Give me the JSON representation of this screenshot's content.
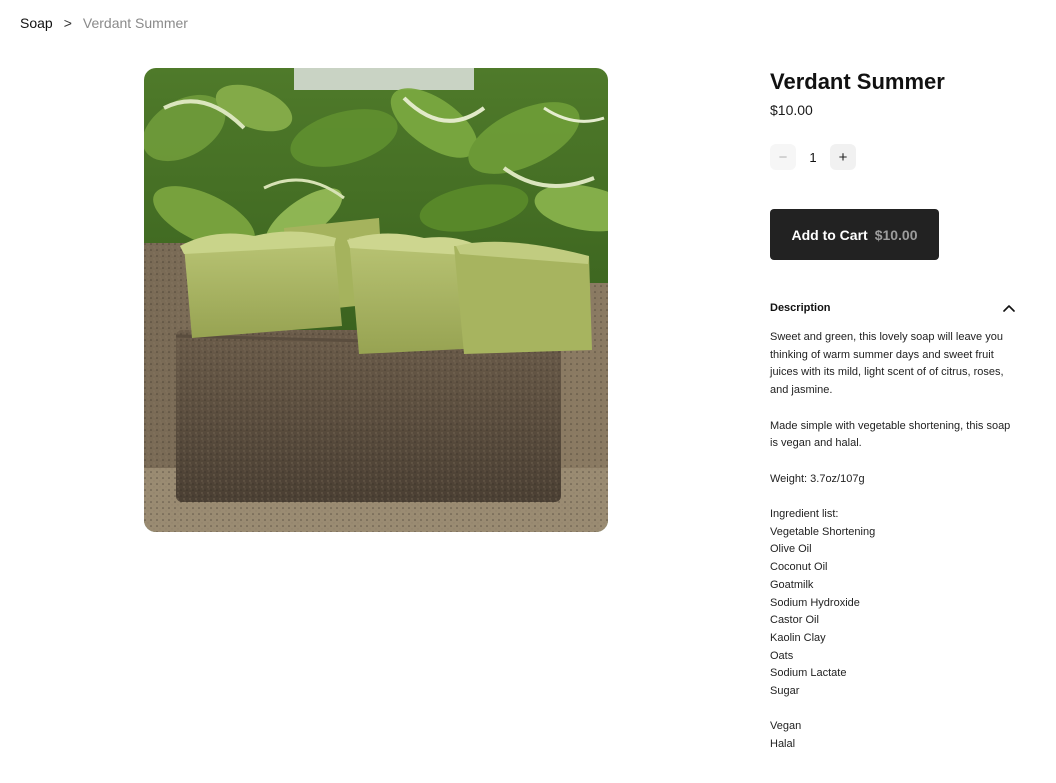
{
  "breadcrumb": {
    "parent": "Soap",
    "separator": ">",
    "current": "Verdant Summer"
  },
  "product": {
    "title": "Verdant Summer",
    "price": "$10.00",
    "image_subject": "green soap bars on stone block with hosta plants"
  },
  "quantity": {
    "decrement_icon": "minus-icon",
    "decrement": "−",
    "value": "1",
    "increment_icon": "plus-icon",
    "increment": "+"
  },
  "cart": {
    "label": "Add to Cart",
    "price": "$10.00"
  },
  "description": {
    "header": "Description",
    "toggle_icon": "chevron-up-icon",
    "paragraphs": [
      "Sweet and green, this lovely soap will leave you thinking of warm summer days and sweet fruit juices with its mild, light scent of of citrus, roses, and jasmine.",
      "Made simple with vegetable shortening, this soap is vegan and halal.",
      "Weight: 3.7oz/107g"
    ],
    "ingredients_heading": "Ingredient list:",
    "ingredients": [
      "Vegetable Shortening",
      "Olive Oil",
      "Coconut Oil",
      "Goatmilk",
      "Sodium Hydroxide",
      "Castor Oil",
      "Kaolin Clay",
      "Oats",
      "Sodium Lactate",
      "Sugar"
    ],
    "tags": [
      "Vegan",
      "Halal"
    ]
  },
  "colors": {
    "button_bg": "#222222",
    "button_price": "#9c9c9c",
    "breadcrumb_current": "#8a8a8a"
  }
}
